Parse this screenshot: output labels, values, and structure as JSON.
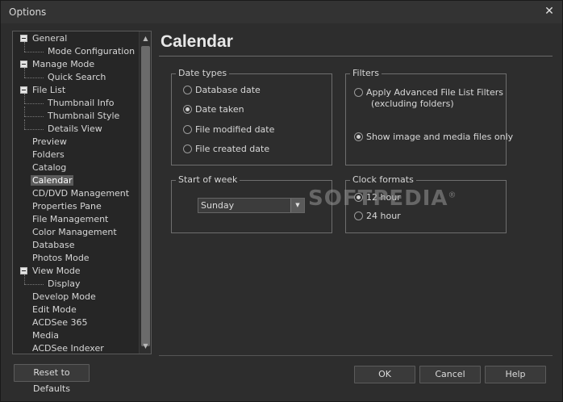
{
  "window": {
    "title": "Options"
  },
  "tree": {
    "items": [
      {
        "label": "General",
        "level": 0,
        "expanded": true
      },
      {
        "label": "Mode Configuration",
        "level": 1
      },
      {
        "label": "Manage Mode",
        "level": 0,
        "expanded": true
      },
      {
        "label": "Quick Search",
        "level": 1
      },
      {
        "label": "File List",
        "level": 0,
        "expanded": true
      },
      {
        "label": "Thumbnail Info",
        "level": 1
      },
      {
        "label": "Thumbnail Style",
        "level": 1
      },
      {
        "label": "Details View",
        "level": 1
      },
      {
        "label": "Preview",
        "level": 0
      },
      {
        "label": "Folders",
        "level": 0
      },
      {
        "label": "Catalog",
        "level": 0
      },
      {
        "label": "Calendar",
        "level": 0,
        "selected": true
      },
      {
        "label": "CD/DVD Management",
        "level": 0
      },
      {
        "label": "Properties Pane",
        "level": 0
      },
      {
        "label": "File Management",
        "level": 0
      },
      {
        "label": "Color Management",
        "level": 0
      },
      {
        "label": "Database",
        "level": 0
      },
      {
        "label": "Photos Mode",
        "level": 0
      },
      {
        "label": "View Mode",
        "level": 0,
        "expanded": true
      },
      {
        "label": "Display",
        "level": 1
      },
      {
        "label": "Develop Mode",
        "level": 0
      },
      {
        "label": "Edit Mode",
        "level": 0
      },
      {
        "label": "ACDSee 365",
        "level": 0
      },
      {
        "label": "Media",
        "level": 0
      },
      {
        "label": "ACDSee Indexer",
        "level": 0
      }
    ]
  },
  "page": {
    "title": "Calendar"
  },
  "date_types": {
    "legend": "Date types",
    "options": [
      {
        "label": "Database date",
        "checked": false
      },
      {
        "label": "Date taken",
        "checked": true
      },
      {
        "label": "File modified date",
        "checked": false
      },
      {
        "label": "File created date",
        "checked": false
      }
    ]
  },
  "filters": {
    "legend": "Filters",
    "options": [
      {
        "label": "Apply Advanced File List Filters",
        "label2": "(excluding folders)",
        "checked": false
      },
      {
        "label": "Show image and media files only",
        "checked": true
      }
    ]
  },
  "start_of_week": {
    "legend": "Start of week",
    "value": "Sunday"
  },
  "clock_formats": {
    "legend": "Clock formats",
    "options": [
      {
        "label": "12 hour",
        "checked": true
      },
      {
        "label": "24 hour",
        "checked": false
      }
    ]
  },
  "watermark": {
    "text": "SOFTPEDIA",
    "mark": "®"
  },
  "buttons": {
    "reset": "Reset to Defaults",
    "ok": "OK",
    "cancel": "Cancel",
    "help": "Help"
  },
  "colors": {
    "background": "#2d2d2d",
    "selection": "#5b5b5b",
    "border": "#6e6e6e"
  }
}
